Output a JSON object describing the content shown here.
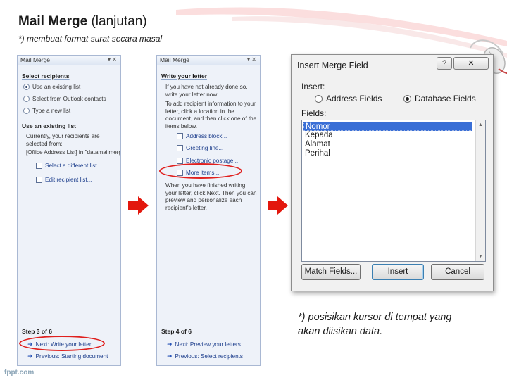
{
  "slide": {
    "title_bold": "Mail Merge",
    "title_rest": " (lanjutan)",
    "subtitle": "*) membuat format surat secara masal",
    "note_line1": "*) posisikan kursor di tempat yang",
    "note_line2": "akan diisikan data.",
    "footer": "fppt.com"
  },
  "pane_left": {
    "header": "Mail Merge",
    "select_recipients": "Select recipients",
    "options": [
      {
        "label": "Use an existing list",
        "selected": true
      },
      {
        "label": "Select from Outlook contacts",
        "selected": false
      },
      {
        "label": "Type a new list",
        "selected": false
      }
    ],
    "use_existing_heading": "Use an existing list",
    "currently_text": "Currently, your recipients are selected from:",
    "source_text": "[Office Address List] in \"datamailmerg",
    "link_select_different": "Select a different list...",
    "link_edit_recipients": "Edit recipient list...",
    "step": "Step 3 of 6",
    "next": "Next: Write your letter",
    "previous": "Previous: Starting document"
  },
  "pane_mid": {
    "write_heading": "Write your letter",
    "intro_text": "If you have not already done so, write your letter now.",
    "add_info_text": "To add recipient information to your letter, click a location in the document, and then click one of the items below.",
    "links": [
      "Address block...",
      "Greeting line...",
      "Electronic postage...",
      "More items..."
    ],
    "finish_text": "When you have finished writing your letter, click Next. Then you can preview and personalize each recipient's letter.",
    "step": "Step 4 of 6",
    "next": "Next: Preview your letters",
    "previous": "Previous: Select recipients"
  },
  "dialog": {
    "title": "Insert Merge Field",
    "help_label": "?",
    "close_label": "✕",
    "insert_label": "Insert:",
    "insert_options": [
      {
        "label": "Address Fields",
        "selected": false
      },
      {
        "label": "Database Fields",
        "selected": true
      }
    ],
    "fields_label": "Fields:",
    "fields": [
      "Nomor",
      "Kepada",
      "Alamat",
      "Perihal"
    ],
    "selected_field": "Nomor",
    "buttons": {
      "match": "Match Fields...",
      "insert": "Insert",
      "cancel": "Cancel"
    }
  },
  "colors": {
    "highlight_ellipse": "#e0201e",
    "arrow_red": "#e3170d",
    "selection": "#3a6fd6"
  }
}
